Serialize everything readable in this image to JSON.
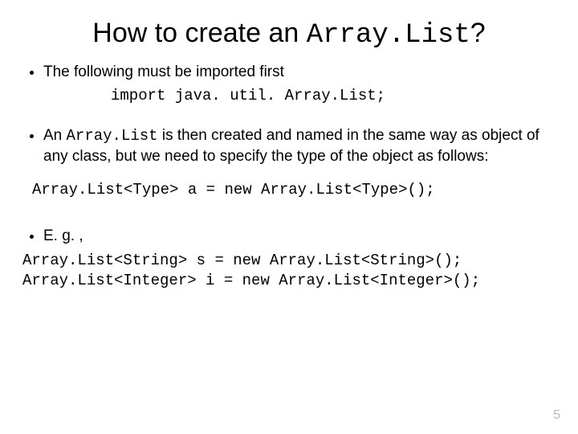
{
  "title": {
    "pre": "How to create an ",
    "mono": "Array.List",
    "post": "?"
  },
  "bullet1": "The following must be imported first",
  "import_line": "import java. util. Array.List;",
  "bullet2": {
    "pre": "An ",
    "mono": "Array.List",
    "post": " is then created and named in the same way as object of any class, but we need to specify the type of the object as follows:"
  },
  "type_code": "Array.List<Type> a = new Array.List<Type>();",
  "bullet3": "E. g. ,",
  "examples": "Array.List<String> s = new Array.List<String>();\nArray.List<Integer> i = new Array.List<Integer>();",
  "page_number": "5"
}
